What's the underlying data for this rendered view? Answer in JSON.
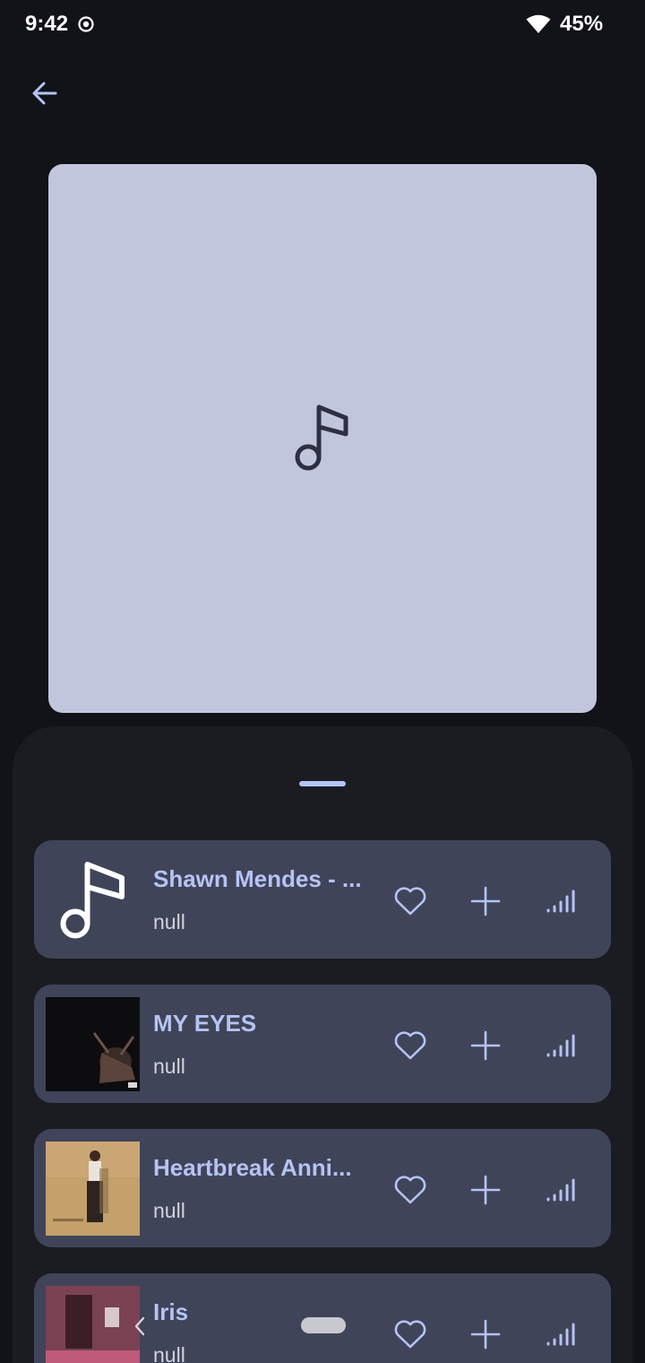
{
  "status_bar": {
    "time": "9:42",
    "battery": "45%"
  },
  "tracks": [
    {
      "title": "Shawn Mendes - ...",
      "subtitle": "null",
      "art": "music-note-icon"
    },
    {
      "title": "MY EYES",
      "subtitle": "null",
      "art": "album-art-dark"
    },
    {
      "title": "Heartbreak Anni...",
      "subtitle": "null",
      "art": "album-art-beige"
    },
    {
      "title": "Iris",
      "subtitle": "null",
      "art": "album-art-pink"
    }
  ],
  "colors": {
    "background": "#121318",
    "sheet": "#1b1c22",
    "card": "#3f4458",
    "accent": "#b6c3f5",
    "artwork_placeholder": "#c1c6dd"
  }
}
